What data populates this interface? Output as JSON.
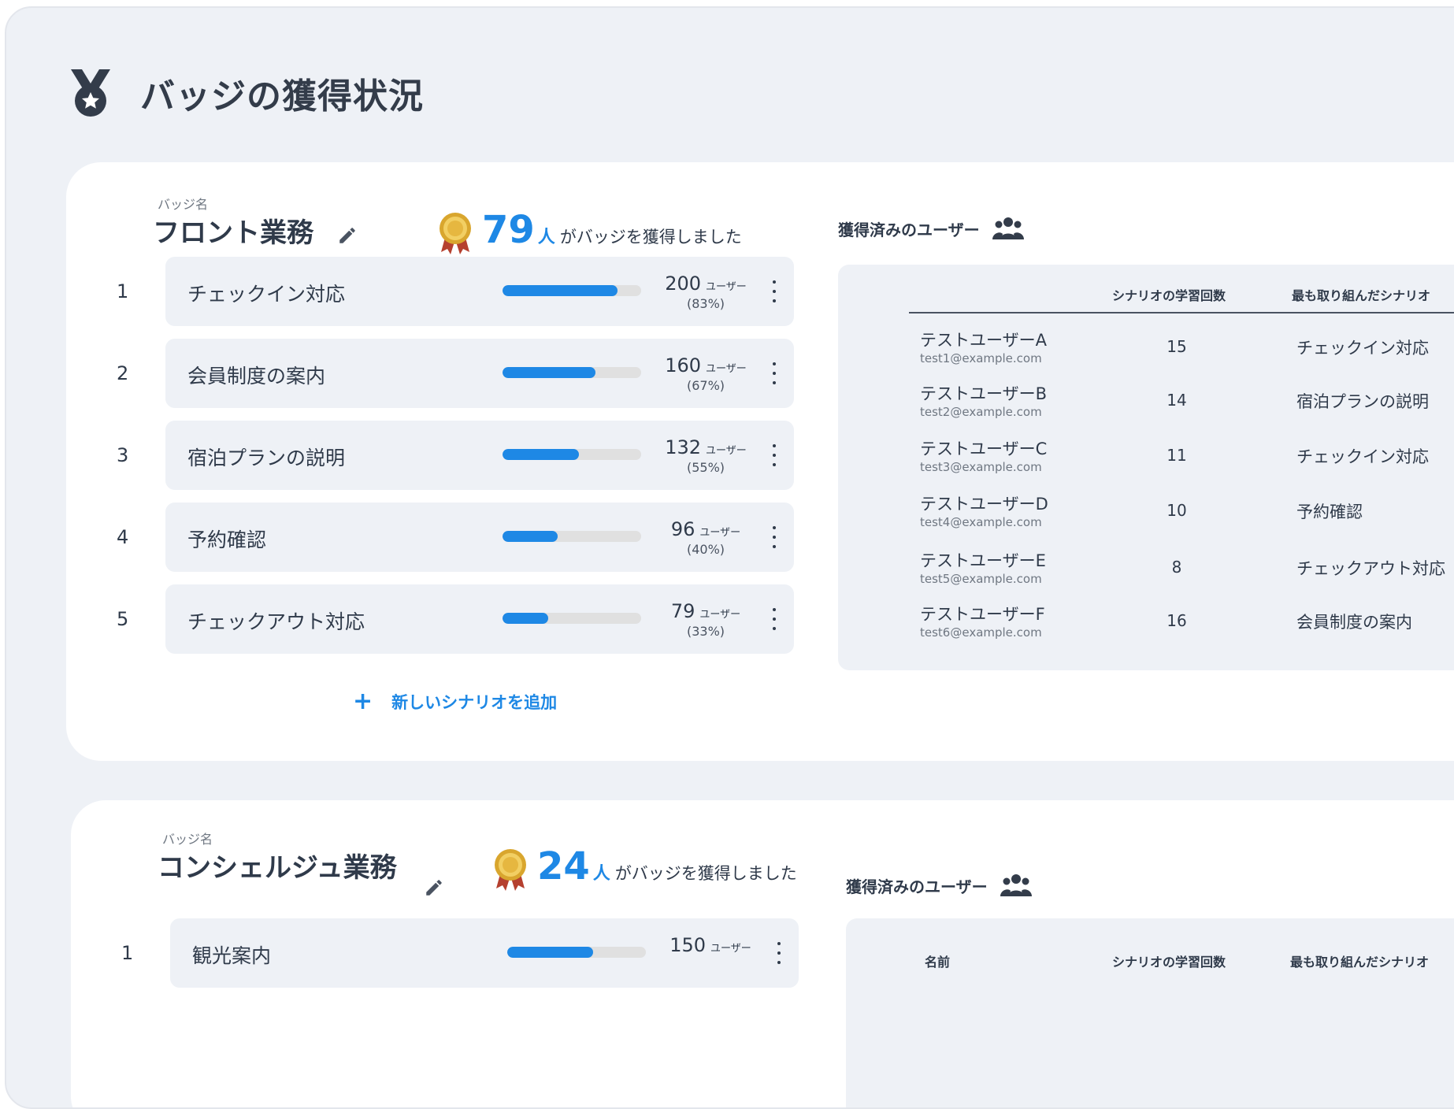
{
  "page": {
    "title": "バッジの獲得状況"
  },
  "badges": [
    {
      "label": "バッジ名",
      "name": "フロント業務",
      "count": "79",
      "count_unit": "人",
      "count_message": "がバッジを獲得しました",
      "scenarios": [
        {
          "rank": "1",
          "name": "チェックイン対応",
          "users": "200",
          "users_suffix": "ユーザー",
          "percent_text": "(83%)",
          "percent": 83
        },
        {
          "rank": "2",
          "name": "会員制度の案内",
          "users": "160",
          "users_suffix": "ユーザー",
          "percent_text": "(67%)",
          "percent": 67
        },
        {
          "rank": "3",
          "name": "宿泊プランの説明",
          "users": "132",
          "users_suffix": "ユーザー",
          "percent_text": "(55%)",
          "percent": 55
        },
        {
          "rank": "4",
          "name": "予約確認",
          "users": "96",
          "users_suffix": "ユーザー",
          "percent_text": "(40%)",
          "percent": 40
        },
        {
          "rank": "5",
          "name": "チェックアウト対応",
          "users": "79",
          "users_suffix": "ユーザー",
          "percent_text": "(33%)",
          "percent": 33
        }
      ],
      "add_label": "新しいシナリオを追加",
      "users_panel": {
        "title": "獲得済みのユーザー",
        "columns": [
          "",
          "シナリオの学習回数",
          "最も取り組んだシナリオ"
        ],
        "rows": [
          {
            "name": "テストユーザーA",
            "email": "test1@example.com",
            "count": "15",
            "scenario": "チェックイン対応"
          },
          {
            "name": "テストユーザーB",
            "email": "test2@example.com",
            "count": "14",
            "scenario": "宿泊プランの説明"
          },
          {
            "name": "テストユーザーC",
            "email": "test3@example.com",
            "count": "11",
            "scenario": "チェックイン対応"
          },
          {
            "name": "テストユーザーD",
            "email": "test4@example.com",
            "count": "10",
            "scenario": "予約確認"
          },
          {
            "name": "テストユーザーE",
            "email": "test5@example.com",
            "count": "8",
            "scenario": "チェックアウト対応"
          },
          {
            "name": "テストユーザーF",
            "email": "test6@example.com",
            "count": "16",
            "scenario": "会員制度の案内"
          }
        ]
      }
    },
    {
      "label": "バッジ名",
      "name": "コンシェルジュ業務",
      "count": "24",
      "count_unit": "人",
      "count_message": "がバッジを獲得しました",
      "scenarios": [
        {
          "rank": "1",
          "name": "観光案内",
          "users": "150",
          "users_suffix": "ユーザー",
          "percent": 62
        }
      ],
      "users_panel": {
        "title": "獲得済みのユーザー",
        "columns": [
          "名前",
          "シナリオの学習回数",
          "最も取り組んだシナリオ"
        ]
      }
    }
  ],
  "colors": {
    "accent": "#1e88e5",
    "background": "#eef1f6",
    "card": "#ffffff",
    "text": "#2f3a4a"
  },
  "icons": {
    "page": "medal-icon",
    "edit": "pencil-icon",
    "award": "award-ribbon-icon",
    "users": "users-group-icon",
    "menu": "more-vertical-icon",
    "add": "plus-icon"
  }
}
